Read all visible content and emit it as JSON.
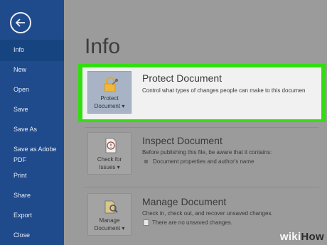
{
  "sidebar": {
    "items": [
      {
        "label": "Info"
      },
      {
        "label": "New"
      },
      {
        "label": "Open"
      },
      {
        "label": "Save"
      },
      {
        "label": "Save As"
      },
      {
        "label": "Save as Adobe"
      },
      {
        "label": "PDF"
      },
      {
        "label": "Print"
      },
      {
        "label": "Share"
      },
      {
        "label": "Export"
      },
      {
        "label": "Close"
      }
    ]
  },
  "main": {
    "title": "Info",
    "protect": {
      "tile_line1": "Protect",
      "tile_line2": "Document ▾",
      "heading": "Protect Document",
      "description": "Control what types of changes people can make to this documen"
    },
    "inspect": {
      "tile_line1": "Check for",
      "tile_line2": "Issues ▾",
      "heading": "Inspect Document",
      "description": "Before publishing this file, be aware that it contains:",
      "bullet": "Document properties and author's name"
    },
    "manage": {
      "tile_line1": "Manage",
      "tile_line2": "Document ▾",
      "heading": "Manage Document",
      "description": "Check in, check out, and recover unsaved changes.",
      "bullet": "There are no unsaved changes."
    }
  },
  "watermark": {
    "wiki": "wiki",
    "how": "How"
  },
  "colors": {
    "sidebar": "#1f4a8c",
    "highlight": "#33dd11",
    "background": "#9b9b9b"
  }
}
